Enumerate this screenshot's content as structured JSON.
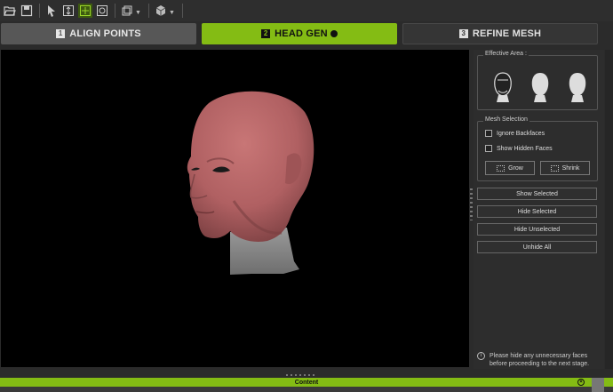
{
  "toolbar": {
    "icons": [
      "open-folder-icon",
      "save-icon",
      "select-arrow-icon",
      "move-icon",
      "focus-icon",
      "frame-icon",
      "view-mode-icon",
      "cube-icon"
    ]
  },
  "tabs": [
    {
      "num": "1",
      "label": "ALIGN POINTS",
      "state": "inactive"
    },
    {
      "num": "2",
      "label": "HEAD GEN",
      "state": "active"
    },
    {
      "num": "3",
      "label": "REFINE MESH",
      "state": "inactive"
    }
  ],
  "panel": {
    "effective_area_title": "Effective Area :",
    "mesh_selection_title": "Mesh Selection",
    "ignore_backfaces": "Ignore Backfaces",
    "show_hidden_faces": "Show Hidden Faces",
    "grow": "Grow",
    "shrink": "Shrink",
    "show_selected": "Show Selected",
    "hide_selected": "Hide Selected",
    "hide_unselected": "Hide Unselected",
    "unhide_all": "Unhide All",
    "info_line1": "Please hide any unnecessary faces",
    "info_line2": "before proceeding to the next stage."
  },
  "bottom": {
    "content_label": "Content"
  },
  "colors": {
    "accent": "#84bc14",
    "skin": "#b8686a",
    "neck": "#8a8a8a"
  }
}
